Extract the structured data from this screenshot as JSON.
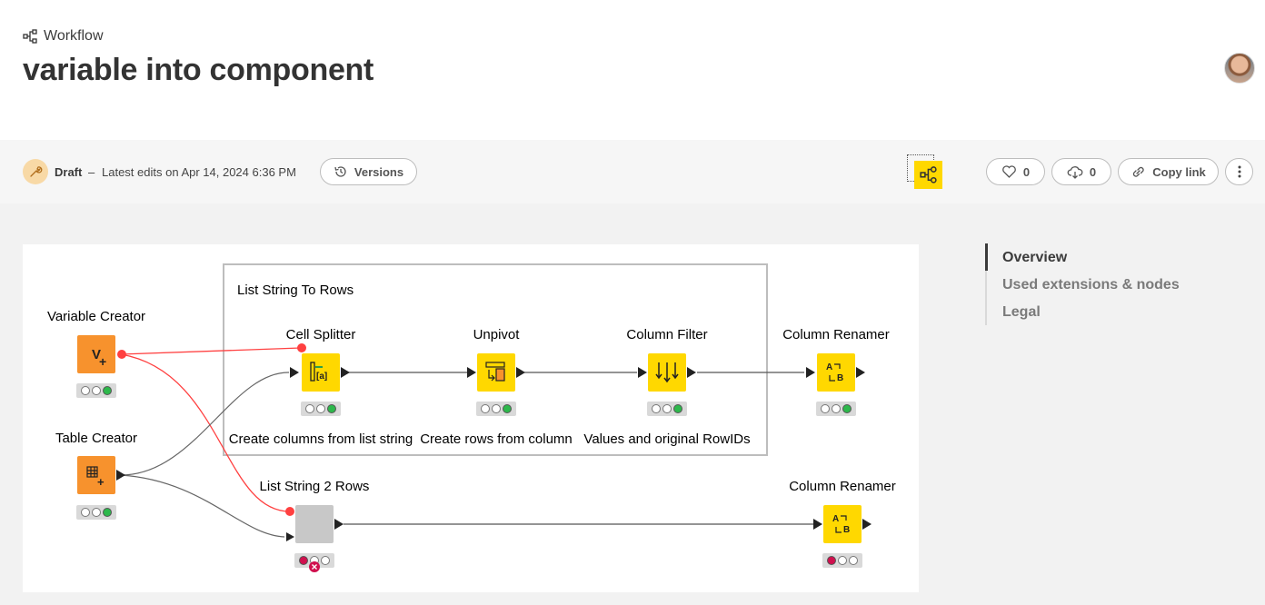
{
  "header": {
    "breadcrumb": "Workflow",
    "title": "variable into component"
  },
  "toolbar": {
    "status": "Draft",
    "separator": "–",
    "last_edits": "Latest edits on Apr 14, 2024 6:36 PM",
    "versions_label": "Versions",
    "likes": "0",
    "downloads": "0",
    "copy_link_label": "Copy link"
  },
  "side_nav": {
    "items": [
      "Overview",
      "Used extensions & nodes",
      "Legal"
    ],
    "active": "Overview"
  },
  "workflow": {
    "component": {
      "title": "List String To Rows",
      "nodes": [
        {
          "name": "Cell Splitter",
          "caption": "Create columns from list string",
          "status": "green",
          "glyph": "split-icon"
        },
        {
          "name": "Unpivot",
          "caption": "Create rows from column",
          "status": "green",
          "glyph": "unpivot-icon"
        },
        {
          "name": "Column Filter",
          "caption": "Values and original RowIDs",
          "status": "green",
          "glyph": "filter-icon"
        }
      ]
    },
    "nodes": [
      {
        "name": "Variable Creator",
        "status": "green",
        "color": "#f7922d",
        "glyph": "variable-creator-icon"
      },
      {
        "name": "Table Creator",
        "status": "green",
        "color": "#f7922d",
        "glyph": "table-creator-icon"
      },
      {
        "name": "Column Renamer",
        "status": "green",
        "color": "#ffd800",
        "glyph": "rename-icon"
      },
      {
        "name": "List String 2 Rows",
        "status": "error",
        "color": "#c8c8c8",
        "glyph": "component-icon"
      },
      {
        "name": "Column Renamer",
        "status": "red",
        "color": "#ffd800",
        "glyph": "rename-icon"
      }
    ],
    "colors": {
      "manipulator": "#ffd800",
      "source": "#f7922d",
      "flow_variable_line": "#ff4040",
      "data_line": "#555555",
      "status_green": "#2db84b",
      "status_red": "#d0104e"
    }
  }
}
